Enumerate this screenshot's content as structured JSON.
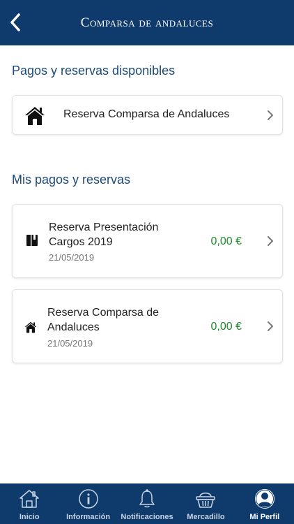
{
  "header": {
    "title": "Comparsa de andaluces",
    "back_icon": "chevron-left-icon"
  },
  "available": {
    "section_title": "Pagos y reservas disponibles",
    "items": [
      {
        "label": "Reserva Comparsa de Andaluces",
        "icon": "house-icon"
      }
    ]
  },
  "mine": {
    "section_title": "Mis pagos y reservas",
    "items": [
      {
        "title_line1": "Reserva Presentación",
        "title_line2": "Cargos 2019",
        "date": "21/05/2019",
        "amount": "0,00 €",
        "icon": "book-icon"
      },
      {
        "title_line1": "Reserva Comparsa de",
        "title_line2": "Andaluces",
        "date": "21/05/2019",
        "amount": "0,00 €",
        "icon": "house-icon"
      }
    ]
  },
  "tabbar": {
    "tabs": [
      {
        "label": "Inicio",
        "icon": "home-icon"
      },
      {
        "label": "Información",
        "icon": "info-icon"
      },
      {
        "label": "Notificaciones",
        "icon": "bell-icon"
      },
      {
        "label": "Mercadillo",
        "icon": "basket-icon"
      },
      {
        "label": "Mi Perfil",
        "icon": "user-icon",
        "active": true
      }
    ]
  },
  "colors": {
    "primary": "#0e3a6c",
    "section_title": "#1d4a7a",
    "amount": "#1e8b2b"
  }
}
